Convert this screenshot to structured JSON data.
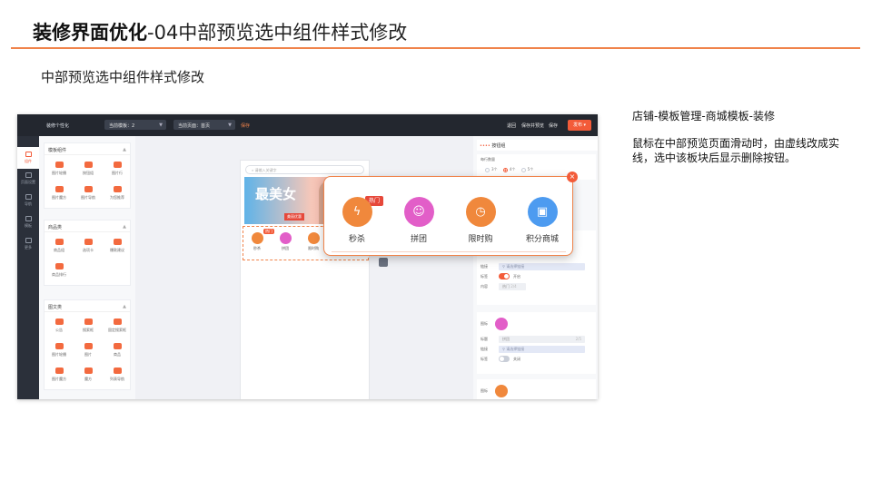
{
  "slide": {
    "title_bold": "装修界面优化",
    "title_rest": "-04中部预览选中组件样式修改",
    "subtitle": "中部预览选中组件样式修改",
    "notes": [
      "店铺-模板管理-商城模板-装修",
      "鼠标在中部预览页面滑动时，由虚线改成实线，选中该板块后显示删除按钮。"
    ]
  },
  "colors": {
    "accent": "#f0834a",
    "primary": "#f35b39",
    "topbar": "#23272f"
  },
  "app": {
    "name": "装修个性化",
    "template_select": "当前模板：2",
    "page_select": "当前页面：首页",
    "save_link": "保存",
    "right_links": [
      "退回",
      "保存并预览",
      "保存"
    ],
    "publish": "发布"
  },
  "leftnav": [
    {
      "label": "组件",
      "icon": "component-icon"
    },
    {
      "label": "页面设置",
      "icon": "page-icon"
    },
    {
      "label": "导航",
      "icon": "nav-icon"
    },
    {
      "label": "模板",
      "icon": "template-icon"
    },
    {
      "label": "更多",
      "icon": "more-icon"
    }
  ],
  "widgets": {
    "groups": [
      {
        "title": "模板组件",
        "items": [
          "图片轮播",
          "按钮组",
          "图片行",
          "图片魔方",
          "图片导航",
          "为您推荐"
        ]
      },
      {
        "title": "商品类",
        "items": [
          "商品组",
          "选项卡",
          "爆款建议",
          "商品排行"
        ]
      },
      {
        "title": "图文类",
        "items": [
          "公告",
          "搜索框",
          "固定搜索框",
          "图片轮播",
          "图片",
          "商品",
          "图片魔方",
          "魔方",
          "列表导航"
        ]
      }
    ]
  },
  "phone": {
    "search_placeholder": "请输入关键字",
    "banner_text": "最美女",
    "banner_tag": "美丽优惠",
    "hot_badge": "热门",
    "nav_items": [
      "秒杀",
      "拼团",
      "限时购"
    ]
  },
  "popup": {
    "hot_badge": "热门",
    "close": "×",
    "items": [
      {
        "label": "秒杀",
        "icon": "flash-sale-icon",
        "color": "#f0883c"
      },
      {
        "label": "拼团",
        "icon": "group-buy-icon",
        "color": "#e25ec8"
      },
      {
        "label": "限时购",
        "icon": "timer-icon",
        "color": "#f0883c"
      },
      {
        "label": "积分商城",
        "icon": "points-mall-icon",
        "color": "#4d9bf0"
      }
    ]
  },
  "props": {
    "title_dots": "••••",
    "title": "按钮组",
    "per_row_label": "每行数量",
    "per_row_options": [
      "3个",
      "4个",
      "5个"
    ],
    "rows": {
      "link_label": "链接",
      "link_placeholder": "请选择链接",
      "badge_label": "标签",
      "badge_on": "开启",
      "badge_off": "关闭",
      "content_label": "内容",
      "content_value": "热门",
      "content_count": "2/4",
      "icon_label": "图标",
      "title_label": "标题",
      "title_value": "拼团",
      "title_count": "2/5"
    }
  }
}
